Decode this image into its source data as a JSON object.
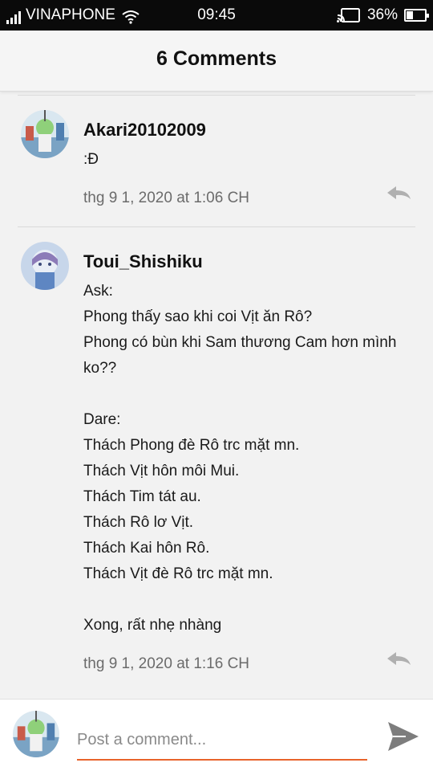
{
  "status_bar": {
    "carrier": "VINAPHONE",
    "time": "09:45",
    "battery_percent": "36%",
    "battery_level": 0.36
  },
  "header": {
    "title": "6 Comments"
  },
  "comments": [
    {
      "author": "Akari20102009",
      "text": ":Đ",
      "timestamp": "thg 9 1, 2020 at 1:06 CH"
    },
    {
      "author": "Toui_Shishiku",
      "text": "Ask:\nPhong thấy sao khi coi Vịt ăn Rô?\nPhong có bùn khi Sam thương Cam hơn mình ko??\n\nDare:\nThách Phong đè Rô trc mặt mn.\nThách Vịt hôn môi Mui.\nThách Tim tát au.\nThách Rô lơ Vịt.\nThách Kai hôn Rô.\nThách Vịt đè Rô trc mặt mn.\n\nXong, rất nhẹ nhàng",
      "timestamp": "thg 9 1, 2020 at 1:16 CH"
    }
  ],
  "composer": {
    "placeholder": "Post a comment..."
  },
  "colors": {
    "accent": "#e8632b",
    "icon_gray": "#b0b0b0",
    "status_bar": "#0a0a0a"
  },
  "icons": [
    "signal-icon",
    "wifi-icon",
    "cast-icon",
    "battery-icon",
    "reply-icon",
    "send-icon"
  ]
}
